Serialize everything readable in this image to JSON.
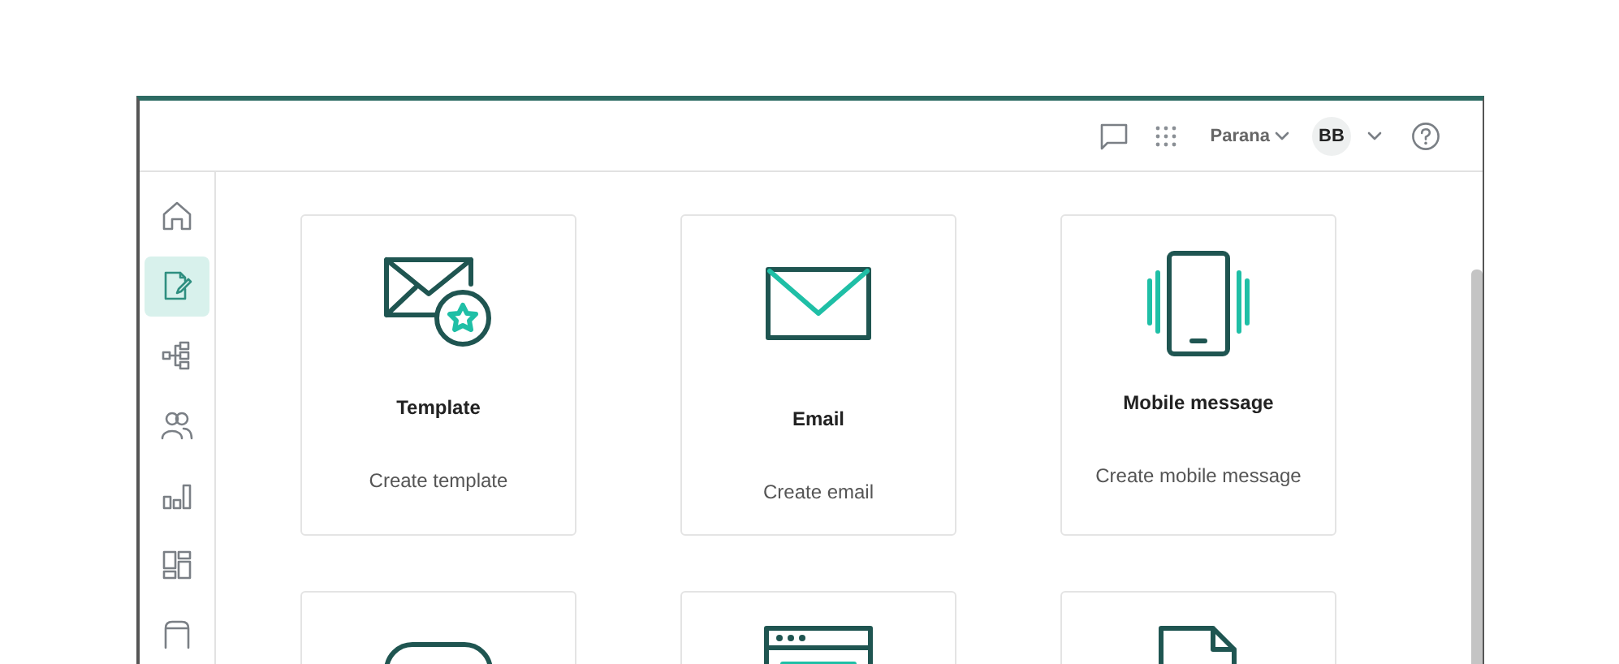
{
  "header": {
    "workspace": "Parana",
    "avatar": "BB"
  },
  "sidebar": {
    "items": [
      {
        "kind": "home",
        "selected": false
      },
      {
        "kind": "document-edit",
        "selected": true
      },
      {
        "kind": "hierarchy",
        "selected": false
      },
      {
        "kind": "people",
        "selected": false
      },
      {
        "kind": "bar-chart",
        "selected": false
      },
      {
        "kind": "dashboard",
        "selected": false
      },
      {
        "kind": "box",
        "selected": false
      }
    ]
  },
  "cards": [
    {
      "kind": "template",
      "title": "Template",
      "description": "Create template"
    },
    {
      "kind": "email",
      "title": "Email",
      "description": "Create email"
    },
    {
      "kind": "mobile",
      "title": "Mobile message",
      "description": "Create mobile message"
    },
    {
      "kind": "chat"
    },
    {
      "kind": "web"
    },
    {
      "kind": "document"
    }
  ]
}
